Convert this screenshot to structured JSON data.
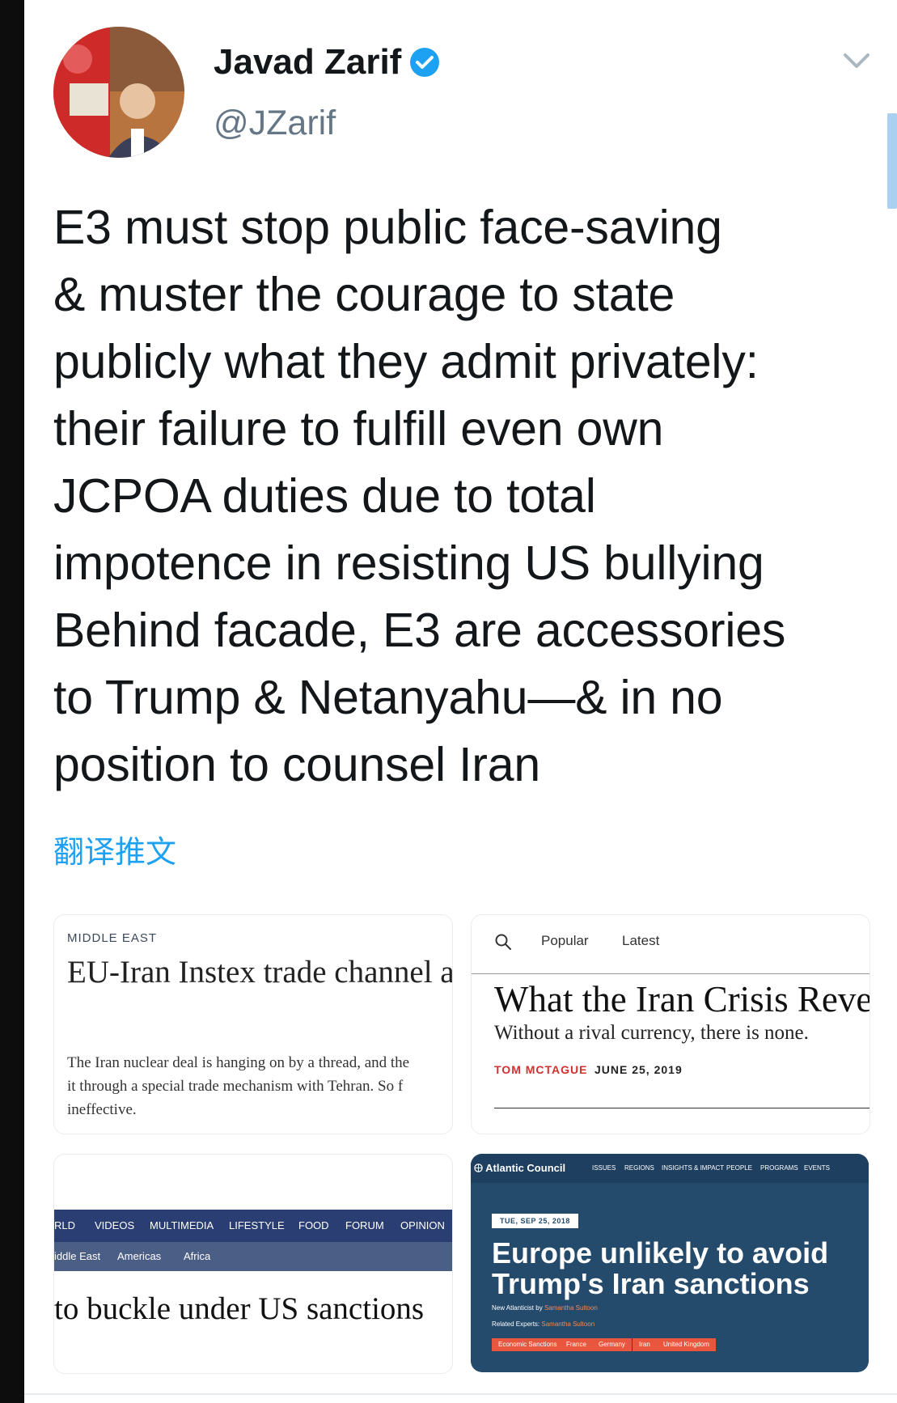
{
  "user": {
    "name": "Javad Zarif",
    "handle": "@JZarif"
  },
  "tweet": {
    "text": "E3 must stop public face-saving\n& muster the courage to state\npublicly what they admit privately:\ntheir failure to fulfill even own\nJCPOA duties due to total\nimpotence in resisting US bullying\nBehind facade, E3 are accessories\nto Trump & Netanyahu—& in no\nposition to counsel Iran",
    "translate_label": "翻译推文"
  },
  "cards": {
    "card1": {
      "category": "MIDDLE EAST",
      "headline": "EU-Iran Instex trade channel a dream",
      "body": "The Iran nuclear deal is hanging on by a thread, and the\nit through a special trade mechanism with Tehran. So f\nineffective."
    },
    "card2": {
      "nav_popular": "Popular",
      "nav_latest": "Latest",
      "headline": "What the Iran Crisis Reveals",
      "subhead": "Without a rival currency, there is none.",
      "author": "TOM MCTAGUE",
      "date": "JUNE 25, 2019"
    },
    "card3": {
      "nav": [
        "RLD",
        "VIDEOS",
        "MULTIMEDIA",
        "LIFESTYLE",
        "FOOD",
        "FORUM",
        "OPINION"
      ],
      "subnav": [
        "iddle East",
        "Americas",
        "Africa"
      ],
      "headline": "to buckle under US sanctions"
    },
    "card4": {
      "logo": "Atlantic Council",
      "nav": [
        "ISSUES",
        "REGIONS",
        "INSIGHTS & IMPACT",
        "PEOPLE",
        "PROGRAMS",
        "EVENTS"
      ],
      "date": "TUE, SEP 25, 2018",
      "headline": "Europe unlikely to avoid\nTrump's Iran sanctions",
      "meta1_label": "New Atlanticist by",
      "meta1_value": "Samantha Sultoon",
      "meta2_label": "Related Experts:",
      "meta2_value": "Samantha Sultoon",
      "tags": [
        "Economic Sanctions",
        "France",
        "Germany",
        "Iran",
        "United Kingdom"
      ]
    }
  },
  "colors": {
    "accent": "#1da1f2",
    "verified": "#1da1f2",
    "atlantic_bg": "#244a6c",
    "tag": "#e8563d"
  },
  "icons": [
    "verified-badge-icon",
    "chevron-down-icon",
    "search-icon",
    "globe-icon"
  ]
}
